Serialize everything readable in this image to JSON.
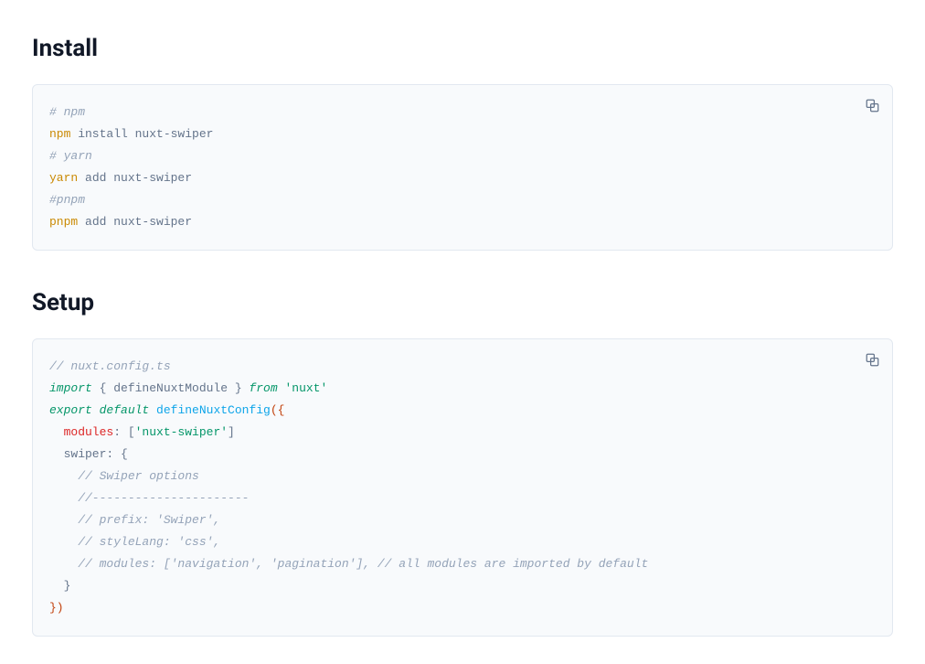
{
  "install": {
    "heading": "Install",
    "code": {
      "l1_comment": "# npm",
      "l2_cmd": "npm",
      "l2_rest": " install nuxt-swiper",
      "l3_comment": "# yarn",
      "l4_cmd": "yarn",
      "l4_rest": " add nuxt-swiper",
      "l5_comment": "#pnpm",
      "l6_cmd": "pnpm",
      "l6_rest": " add nuxt-swiper"
    }
  },
  "setup": {
    "heading": "Setup",
    "code": {
      "l1_comment": "// nuxt.config.ts",
      "l2_kw1": "import",
      "l2_pl1": " { defineNuxtModule } ",
      "l2_kw2": "from",
      "l2_str": " 'nuxt'",
      "l3_kw1": "export",
      "l3_kw2": " default",
      "l3_fn": " defineNuxtConfig",
      "l3_op": "({",
      "l4_prop": "  modules",
      "l4_pl1": ": [",
      "l4_str": "'nuxt-swiper'",
      "l4_pl2": "]",
      "l5_pl": "  swiper: {",
      "l6_comment": "    // Swiper options",
      "l7_comment": "    //----------------------",
      "l8_comment": "    // prefix: 'Swiper',",
      "l9_comment": "    // styleLang: 'css',",
      "l10_comment": "    // modules: ['navigation', 'pagination'], // all modules are imported by default",
      "l11_pl": "  }",
      "l12_op": "})"
    }
  }
}
